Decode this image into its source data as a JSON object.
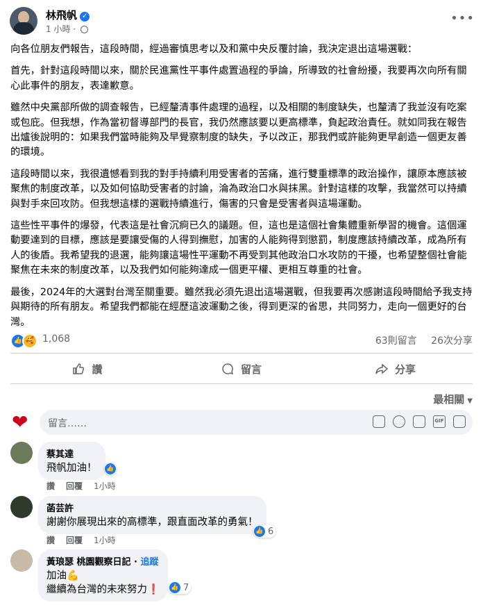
{
  "post": {
    "author": "林飛帆",
    "time": "1 小時",
    "paragraphs": [
      "向各位朋友們報告，這段時間，經過審慎思考以及和黨中央反覆討論，我決定退出這場選戰：",
      "首先，針對這段時間以來，關於民進黨性平事件處置過程的爭論，所導致的社會紛擾，我要再次向所有關心此事件的朋友，表達歉意。",
      "雖然中央黨部所做的調查報告，已經釐清事件處理的過程，以及相關的制度缺失，也釐清了我並沒有吃案或包庇。但我想，作為當初督導部門的長官，我仍然應該要以更高標準，負起政治責任。就如同我在報告出爐後說明的：如果我們當時能夠及早覺察制度的缺失，予以改正，那我們或許能夠更早創造一個更友善的環境。",
      "這段時間以來，我很遺憾看到我的對手持續利用受害者的苦痛，進行雙重標準的政治操作，讓原本應該被聚焦的制度改革，以及如何協助受害者的討論，淪為政治口水與抹黑。針對這樣的攻擊，我當然可以持續與對手來回攻防。但我想這樣的選戰持續進行，傷害的只會是受害者與這場運動。",
      "這些性平事件的爆發，代表這是社會沉痾已久的議題。但，這也是這個社會集體重新學習的機會。這個運動要達到的目標，應該是要讓受傷的人得到撫慰，加害的人能夠得到懲罰，制度應該持續改革，成為所有人的後盾。我希望我的退選，能夠讓這場性平運動不再受到其他政治口水攻防的干擾，也希望整個社會能聚焦在未來的制度改革，以及我們如何能夠達成一個更平權、更相互尊重的社會。",
      "最後，2024年的大選對台灣至關重要。雖然我必須先退出這場選戰，但我要再次感謝這段時間給予我支持與期待的所有朋友。希望我們都能在經歷這波運動之後，得到更深的省思，共同努力，走向一個更好的台灣。"
    ],
    "reaction_count": "1,068",
    "comment_count": "63則留言",
    "share_count": "26次分享"
  },
  "actions": {
    "like": "讚",
    "comment": "留言",
    "share": "分享"
  },
  "sort_label": "最相關",
  "composer_placeholder": "留言……",
  "comments": [
    {
      "name": "蔡其達",
      "text": "飛帆加油！",
      "like": "讚",
      "reply": "回覆",
      "time": "1小時",
      "likes": ""
    },
    {
      "name": "菡芸許",
      "text": "謝謝你展現出來的高標準，跟直面改革的勇氣！",
      "like": "讚",
      "reply": "回覆",
      "time": "1小時",
      "likes": "6"
    },
    {
      "name": "黃琅瑟 桃園觀察日記",
      "follow": "追蹤",
      "line1": "加油💪",
      "line2": "繼續為台灣的未來努力❗",
      "likes": "7"
    }
  ],
  "colors": {
    "accent": "#1877f2",
    "text": "#050505",
    "secondary": "#65676b",
    "bubble": "#f0f2f5"
  }
}
